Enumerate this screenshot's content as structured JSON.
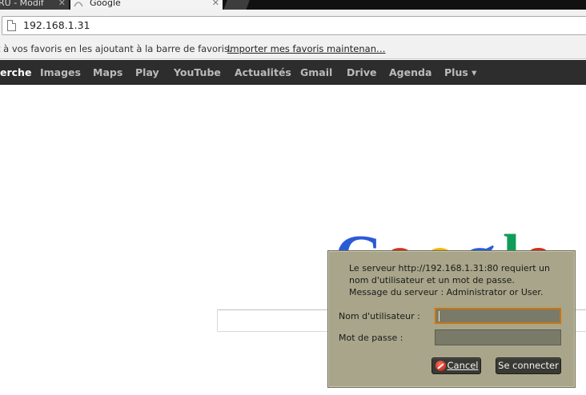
{
  "browser": {
    "tabs": [
      {
        "title": "RU - Modif",
        "close": "✕"
      },
      {
        "title": "Google",
        "close": "✕"
      }
    ],
    "address": "192.168.1.31",
    "bookmarks_bar": {
      "text": "t à vos favoris en les ajoutant à la barre de favoris.",
      "link": "Importer mes favoris maintenan…"
    }
  },
  "google_bar": {
    "items": [
      "erche",
      "Images",
      "Maps",
      "Play",
      "YouTube",
      "Actualités",
      "Gmail",
      "Drive",
      "Agenda",
      "Plus ▾"
    ]
  },
  "dialog": {
    "message_line1": "Le serveur http://192.168.1.31:80 requiert un",
    "message_line2": "nom d'utilisateur et un mot de passe.",
    "message_line3": "Message du serveur : Administrator or User.",
    "username_label": "Nom d'utilisateur :",
    "password_label": "Mot de passe :",
    "username_value": "",
    "password_value": "",
    "cancel_label": "Cancel",
    "connect_label": "Se connecter"
  },
  "colors": {
    "gbar": "#2d2d2d",
    "dialog_bg": "#a8a58a",
    "field_focus": "#c2761d"
  }
}
